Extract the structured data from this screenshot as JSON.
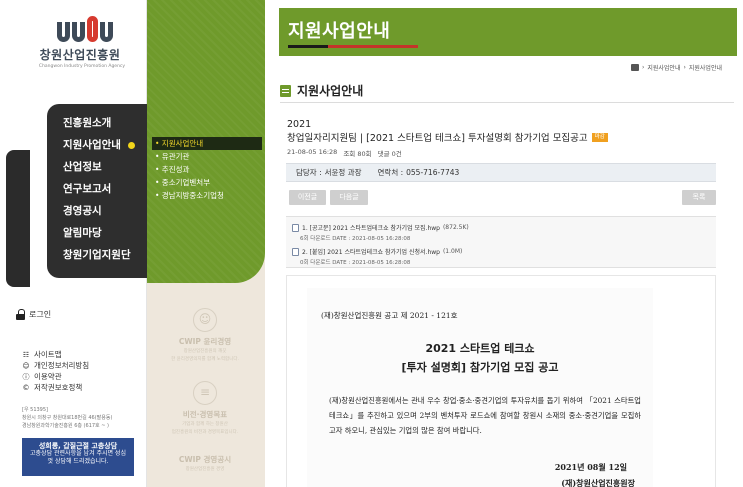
{
  "logo": {
    "mark_letters": "cwip",
    "title": "창원산업진흥원",
    "subtitle": "Changwon Industry Promotion Agency"
  },
  "main_menu": [
    {
      "label": "진흥원소개",
      "active": false
    },
    {
      "label": "지원사업안내",
      "active": true
    },
    {
      "label": "산업정보",
      "active": false
    },
    {
      "label": "연구보고서",
      "active": false
    },
    {
      "label": "경영공시",
      "active": false
    },
    {
      "label": "알림마당",
      "active": false
    },
    {
      "label": "창원기업지원단",
      "active": false
    }
  ],
  "login_label": "로그인",
  "util_links": [
    {
      "label": "사이트맵",
      "icon": "sitemap-icon"
    },
    {
      "label": "개인정보처리방침",
      "icon": "person-icon"
    },
    {
      "label": "이용약관",
      "icon": "info-icon"
    },
    {
      "label": "저작권보호정책",
      "icon": "copyright-icon"
    }
  ],
  "address": {
    "line1": "[우 51395]",
    "line2": "창원시 의창구 창원대로18번길 46(팔용동)",
    "line3": "경남창원과학기술진흥원 6층 (617호 ~ )"
  },
  "banner": {
    "title": "성희롱, 갑질근절 고충상담",
    "line1": "고충상담 관련사항을 남겨 주시면 성심",
    "line2": "껏 상담해 드리겠습니다."
  },
  "sub_menu": [
    {
      "label": "• 지원사업안내",
      "active": true
    },
    {
      "label": "• 유관기관",
      "active": false
    },
    {
      "label": "• 추진성과",
      "active": false
    },
    {
      "label": "• 중소기업벤처부",
      "active": false
    },
    {
      "label": "• 경남지방중소기업청",
      "active": false
    }
  ],
  "values": [
    {
      "title": "CWIP 윤리경영",
      "desc1": "창원산업진흥원의 깨끗",
      "desc2": "한 윤리경영의지를 함께 노력합니다."
    },
    {
      "title": "비전·경영목표",
      "desc1": "기업과 함께 하는 창원산",
      "desc2": "업진흥원의 비전과 경영목표입니다."
    },
    {
      "title": "CWIP 경영공시",
      "desc1": "창원산업진흥원 경영",
      "desc2": "정보를 공개합니다."
    }
  ],
  "header": {
    "title": "지원사업안내"
  },
  "breadcrumb": [
    "지원사업안내",
    "지원사업안내"
  ],
  "section_title": "지원사업안내",
  "post": {
    "year": "2021",
    "title": "창업일자리지원팀 | [2021 스타트업 테크쇼] 투자설명회 참가기업 모집공고",
    "badge": "마감",
    "date": "21-08-05 16:28",
    "views": "조회 80회",
    "comments": "댓글 0건"
  },
  "contact": {
    "manager_label": "담당자 :",
    "manager": "서윤정 과장",
    "phone_label": "연락처 :",
    "phone": "055-716-7743"
  },
  "buttons": {
    "prev": "이전글",
    "next": "다음글",
    "list": "목록"
  },
  "attachments": [
    {
      "name": "1. [공고문] 2021 스타트업테크쇼 참가기업 모집.hwp",
      "size": "(872.5K)",
      "meta": "6회 다운로드 DATE : 2021-08-05 16:28:08"
    },
    {
      "name": "2. [붙임] 2021 스타트업테크쇼 참가기업 신청서.hwp",
      "size": "(1.0M)",
      "meta": "0회 다운로드 DATE : 2021-08-05 16:28:08"
    }
  ],
  "notice": {
    "number": "(재)창원산업진흥원 공고 제 2021 - 121호",
    "heading1": "2021 스타트업 테크쇼",
    "heading2": "[투자 설명회] 참가기업 모집 공고",
    "body": "(재)창원산업진흥원에서는 관내 우수 창업·중소·중견기업의 투자유치를 돕기 위하여 「2021 스타트업 테크쇼」를 추진하고 있으며 2부의 벤처투자 로드쇼에 참여할 창원시 소재의 중소·중견기업을 모집하고자 하오니, 관심있는 기업의 많은 참여 바랍니다.",
    "date": "2021년 08월 12일",
    "org": "(재)창원산업진흥원장"
  }
}
